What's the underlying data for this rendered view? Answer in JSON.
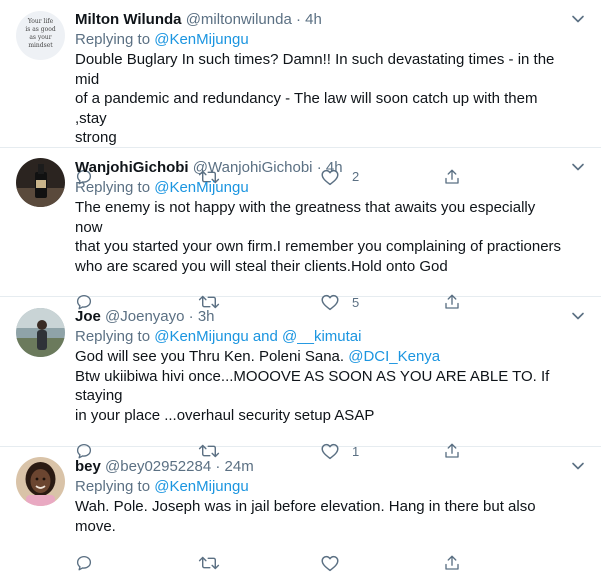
{
  "tweets": [
    {
      "name": "Milton Wilunda",
      "handle": "@miltonwilunda",
      "time": "4h",
      "replying_label": "Replying to",
      "replying_to": [
        "@KenMijungu"
      ],
      "replying_sep": "",
      "text_lines": [
        "Double Buglary In such times? Damn!! In such devastating times - in the mid",
        "of a pandemic and redundancy - The law will soon catch up with them ,stay",
        "strong"
      ],
      "avatar": "text-image-avatar",
      "avatar_text": [
        "Your life",
        "is as good",
        "as your",
        "mindset"
      ],
      "like_count": "2",
      "reply_count": "",
      "retweet_count": ""
    },
    {
      "name": "WanjohiGichobi",
      "handle": "@WanjohiGichobi",
      "time": "4h",
      "replying_label": "Replying to",
      "replying_to": [
        "@KenMijungu"
      ],
      "replying_sep": "",
      "text_lines": [
        "The enemy is not happy with the greatness that awaits you especially now",
        "that you started your own firm.I remember you complaining of practioners",
        "who are scared you will steal their clients.Hold onto God"
      ],
      "avatar": "bottle-photo-avatar",
      "like_count": "5",
      "reply_count": "",
      "retweet_count": ""
    },
    {
      "name": "Joe",
      "handle": "@Joenyayo",
      "time": "3h",
      "replying_label": "Replying to",
      "replying_to": [
        "@KenMijungu",
        "@__kimutai"
      ],
      "replying_sep": " and ",
      "text_first": "God will see you Thru Ken. Poleni Sana. ",
      "text_mention": "@DCI_Kenya",
      "text_lines": [
        "Btw ukiibiwa hivi once...MOOOVE AS SOON AS YOU ARE ABLE TO. If staying",
        "in your place ...overhaul security setup ASAP"
      ],
      "avatar": "outdoor-photo-avatar",
      "like_count": "1",
      "reply_count": "",
      "retweet_count": ""
    },
    {
      "name": "bey",
      "handle": "@bey02952284",
      "time": "24m",
      "replying_label": "Replying to",
      "replying_to": [
        "@KenMijungu"
      ],
      "replying_sep": "",
      "text_lines": [
        "Wah. Pole. Joseph was in jail before elevation. Hang in there but also move."
      ],
      "avatar": "portrait-photo-avatar",
      "like_count": "",
      "reply_count": "",
      "retweet_count": ""
    }
  ],
  "separator_dot": "·",
  "colors": {
    "link": "#1b95e0",
    "secondary": "#5b7083",
    "border": "#e6ecf0"
  }
}
